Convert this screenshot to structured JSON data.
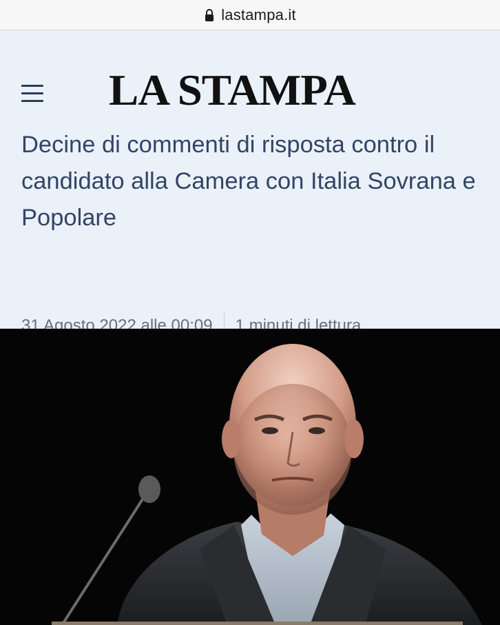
{
  "browser": {
    "url": "lastampa.it"
  },
  "site": {
    "logo": "LA STAMPA"
  },
  "article": {
    "headline": "Decine di commenti di risposta contro il candidato alla Camera con Italia Sovrana e Popolare",
    "date": "31 Agosto 2022 alle 00:09",
    "read_time": "1 minuti di lettura"
  },
  "colors": {
    "header_bg": "#eaf1f8",
    "headline": "#334466",
    "meta": "#6a6f78",
    "menu_icon": "#2a3b5a"
  },
  "icons": {
    "lock": "lock-icon",
    "menu": "hamburger-menu-icon"
  }
}
